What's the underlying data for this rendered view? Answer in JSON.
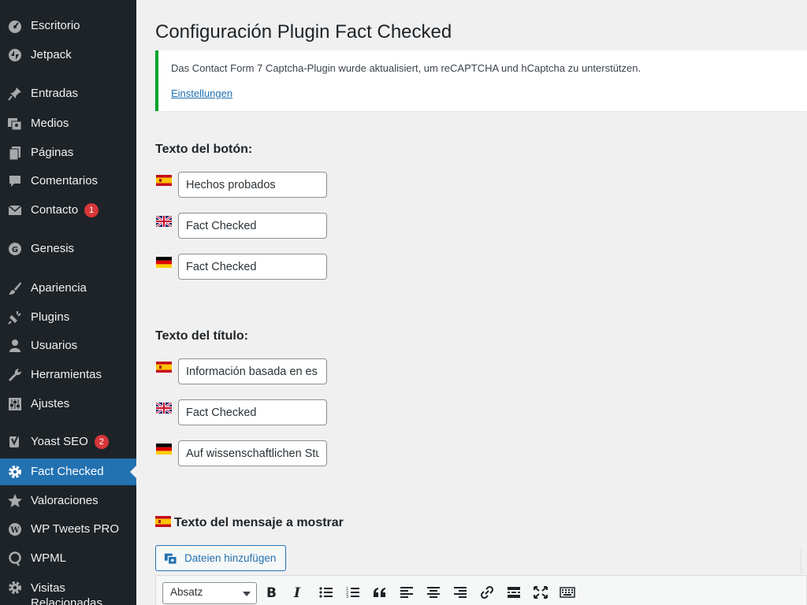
{
  "sidebar": {
    "items": [
      {
        "label": "Escritorio",
        "icon": "dashboard-icon"
      },
      {
        "label": "Jetpack",
        "icon": "jetpack-icon"
      },
      {
        "label": "Entradas",
        "icon": "pin-icon"
      },
      {
        "label": "Medios",
        "icon": "media-icon"
      },
      {
        "label": "Páginas",
        "icon": "pages-icon"
      },
      {
        "label": "Comentarios",
        "icon": "comments-icon"
      },
      {
        "label": "Contacto",
        "icon": "mail-icon",
        "badge": "1"
      },
      {
        "label": "Genesis",
        "icon": "genesis-icon"
      },
      {
        "label": "Apariencia",
        "icon": "brush-icon"
      },
      {
        "label": "Plugins",
        "icon": "plugin-icon"
      },
      {
        "label": "Usuarios",
        "icon": "user-icon"
      },
      {
        "label": "Herramientas",
        "icon": "wrench-icon"
      },
      {
        "label": "Ajustes",
        "icon": "settings-sliders-icon"
      },
      {
        "label": "Yoast SEO",
        "icon": "yoast-icon",
        "badge": "2"
      },
      {
        "label": "Fact Checked",
        "icon": "gear-icon",
        "active": true
      },
      {
        "label": "Valoraciones",
        "icon": "star-icon"
      },
      {
        "label": "WP Tweets PRO",
        "icon": "wordpress-icon"
      },
      {
        "label": "WPML",
        "icon": "wpml-icon"
      },
      {
        "label": "Visitas Relacionadas",
        "icon": "gear-icon"
      }
    ],
    "colors": {
      "background": "#1d2327",
      "active": "#2271b1",
      "badge": "#d63638"
    }
  },
  "page": {
    "title": "Configuración Plugin Fact Checked"
  },
  "notice": {
    "text": "Das Contact Form 7 Captcha-Plugin wurde aktualisiert, um reCAPTCHA und hCaptcha zu unterstützen.",
    "link": "Einstellungen",
    "border_color": "#00a32a"
  },
  "button_text": {
    "heading": "Texto del botón:",
    "fields": [
      {
        "lang": "es",
        "value": "Hechos probados"
      },
      {
        "lang": "en",
        "value": "Fact Checked"
      },
      {
        "lang": "de",
        "value": "Fact Checked"
      }
    ]
  },
  "title_text": {
    "heading": "Texto del título:",
    "fields": [
      {
        "lang": "es",
        "value": "Información basada en es"
      },
      {
        "lang": "en",
        "value": "Fact Checked"
      },
      {
        "lang": "de",
        "value": "Auf wissenschaftlichen Stu"
      }
    ]
  },
  "message": {
    "heading": "Texto del mensaje a mostrar",
    "media_button": "Dateien hinzufügen",
    "format_select": "Absatz",
    "toolbar_icons": [
      "bold-icon",
      "italic-icon",
      "bullet-list-icon",
      "numbered-list-icon",
      "blockquote-icon",
      "align-left-icon",
      "align-center-icon",
      "align-right-icon",
      "link-icon",
      "read-more-icon",
      "fullscreen-icon",
      "toolbar-toggle-icon"
    ]
  }
}
